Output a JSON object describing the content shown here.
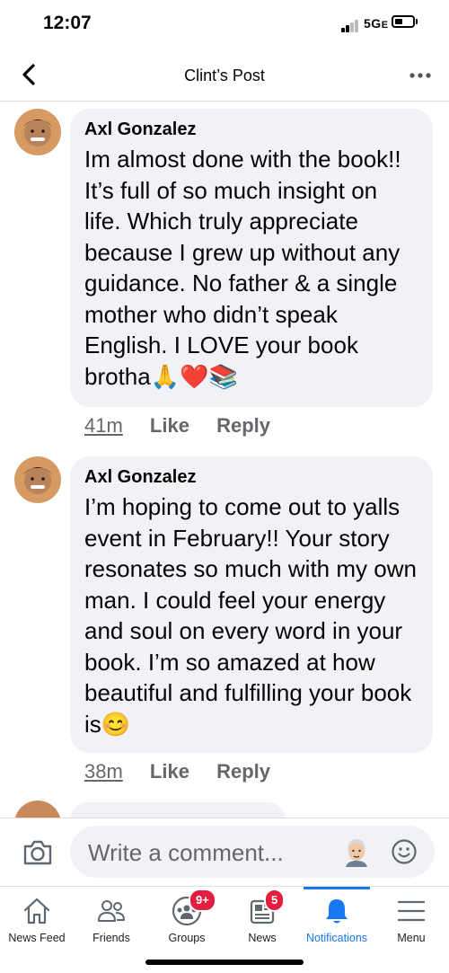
{
  "status": {
    "time": "12:07",
    "network": "5G",
    "network_suffix": "E"
  },
  "header": {
    "back_icon": "chevron-left-icon",
    "title": "Clint’s Post",
    "more_icon": "more-horizontal-icon"
  },
  "comments": [
    {
      "author": "Axl Gonzalez",
      "text": "Im almost done with the book!! It’s full of so much insight on life. Which truly appreciate because I grew up without any guidance. No father & a single mother who didn’t speak English. I LOVE your book brotha🙏❤️📚",
      "time": "41m",
      "like": "Like",
      "reply": "Reply"
    },
    {
      "author": "Axl Gonzalez",
      "text": "I’m hoping to come out to yalls event in February!! Your story resonates so much with my own man. I could feel your energy and soul on every word in your book. I’m so amazed at how beautiful and fulfilling your book is😊",
      "time": "38m",
      "like": "Like",
      "reply": "Reply"
    }
  ],
  "composer": {
    "placeholder": "Write a comment...",
    "camera_icon": "camera-icon",
    "emoji_icon": "smiley-icon",
    "avatar_icon": "memoji-avatar-icon"
  },
  "tabs": [
    {
      "label": "News Feed",
      "icon": "home-icon"
    },
    {
      "label": "Friends",
      "icon": "friends-icon"
    },
    {
      "label": "Groups",
      "icon": "groups-icon",
      "badge": "9+"
    },
    {
      "label": "News",
      "icon": "news-icon",
      "badge": "5"
    },
    {
      "label": "Notifications",
      "icon": "bell-icon",
      "active": true
    },
    {
      "label": "Menu",
      "icon": "menu-icon"
    }
  ],
  "colors": {
    "accent": "#1877f2",
    "badge": "#e41e3f",
    "bubble": "#f0f2f5",
    "secondary_text": "#65676b"
  }
}
